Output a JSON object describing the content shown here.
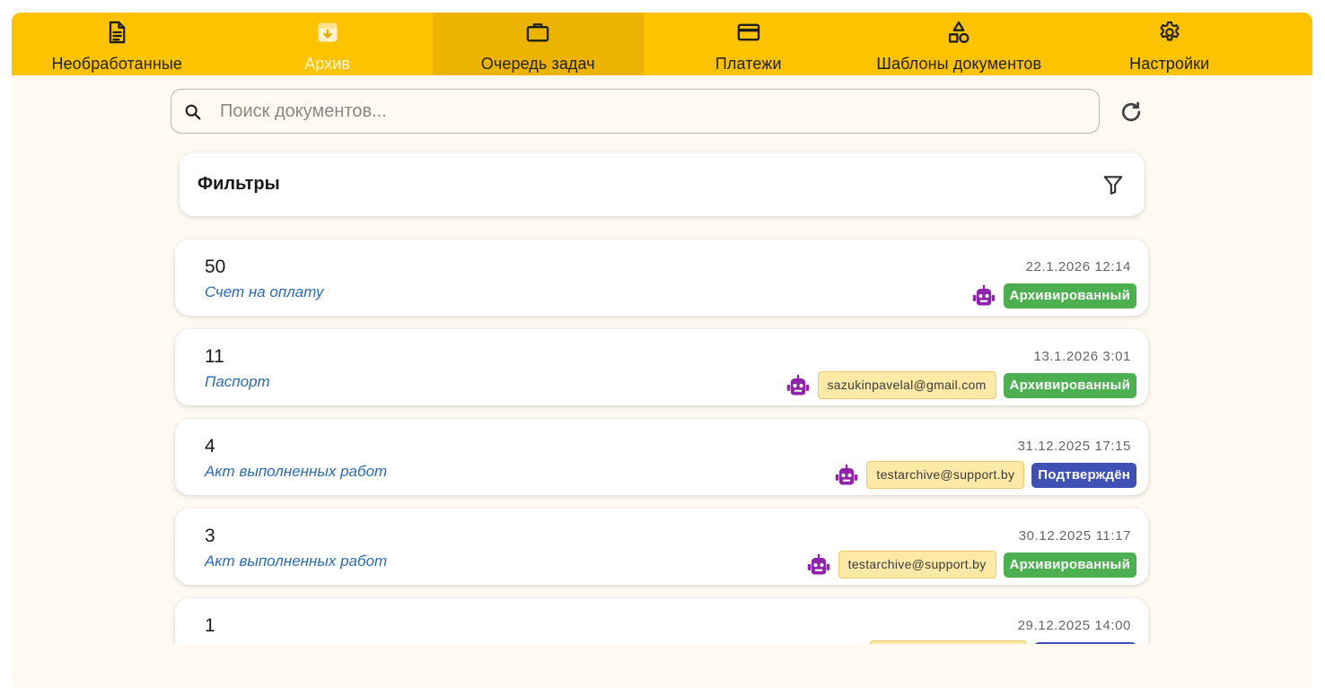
{
  "nav": {
    "tabs": [
      {
        "label": "Необработанные",
        "icon": "document-icon",
        "state": "normal"
      },
      {
        "label": "Архив",
        "icon": "archive-icon",
        "state": "muted"
      },
      {
        "label": "Очередь задач",
        "icon": "briefcase-icon",
        "state": "active"
      },
      {
        "label": "Платежи",
        "icon": "credit-card-icon",
        "state": "normal"
      },
      {
        "label": "Шаблоны документов",
        "icon": "shapes-icon",
        "state": "normal"
      },
      {
        "label": "Настройки",
        "icon": "gear-icon",
        "state": "normal"
      }
    ]
  },
  "search": {
    "placeholder": "Поиск документов...",
    "value": ""
  },
  "filters": {
    "title": "Фильтры"
  },
  "colors": {
    "nav_bg": "#fdc300",
    "nav_active": "#ecb400",
    "page_bg": "#fffaf1",
    "link": "#2b6cb0",
    "robot": "#8e24aa",
    "status_archived": "#4caf50",
    "status_confirmed": "#3f51b5",
    "email_bg": "#ffe9a6"
  },
  "documents": [
    {
      "number": "50",
      "type": "Счет на оплату",
      "date": "22.1.2026 12:14",
      "email": "",
      "status": "Архивированный",
      "status_color": "#4caf50"
    },
    {
      "number": "11",
      "type": "Паспорт",
      "date": "13.1.2026 3:01",
      "email": "sazukinpavelal@gmail.com",
      "status": "Архивированный",
      "status_color": "#4caf50"
    },
    {
      "number": "4",
      "type": "Акт выполненных работ",
      "date": "31.12.2025 17:15",
      "email": "testarchive@support.by",
      "status": "Подтверждён",
      "status_color": "#3f51b5"
    },
    {
      "number": "3",
      "type": "Акт выполненных работ",
      "date": "30.12.2025 11:17",
      "email": "testarchive@support.by",
      "status": "Архивированный",
      "status_color": "#4caf50"
    },
    {
      "number": "1",
      "type": "",
      "date": "29.12.2025 14:00",
      "email": "",
      "status": "",
      "status_color": "#3f51b5"
    }
  ]
}
